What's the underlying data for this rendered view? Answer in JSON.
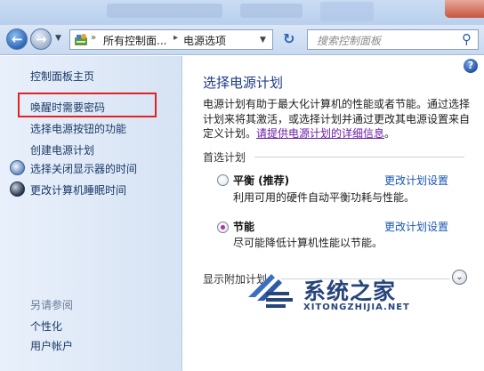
{
  "nav": {
    "breadcrumb": [
      "所有控制面...",
      "电源选项"
    ],
    "search_placeholder": "搜索控制面板"
  },
  "sidebar": {
    "items": [
      {
        "label": "控制面板主页"
      },
      {
        "label": "唤醒时需要密码"
      },
      {
        "label": "选择电源按钮的功能"
      },
      {
        "label": "创建电源计划"
      },
      {
        "label": "选择关闭显示器的时间"
      },
      {
        "label": "更改计算机睡眠时间"
      }
    ],
    "see_also_label": "另请参阅",
    "see_also": [
      {
        "label": "个性化"
      },
      {
        "label": "用户帐户"
      }
    ]
  },
  "main": {
    "title": "选择电源计划",
    "description": "电源计划有助于最大化计算机的性能或者节能。通过选择计划来将其激活，或选择计划并通过更改其电源设置来自定义计划。",
    "description_link": "请提供电源计划的详细信息",
    "description_end": "。",
    "preferred_label": "首选计划",
    "plans": [
      {
        "name": "平衡 (推荐)",
        "desc": "利用可用的硬件自动平衡功耗与性能。",
        "link": "更改计划设置",
        "selected": false
      },
      {
        "name": "节能",
        "desc": "尽可能降低计算机性能以节能。",
        "link": "更改计划设置",
        "selected": true
      }
    ],
    "extra_plans_label": "显示附加计划"
  },
  "watermark": {
    "title": "系统之家",
    "subtitle": "XITONGZHIJIA.NET"
  }
}
